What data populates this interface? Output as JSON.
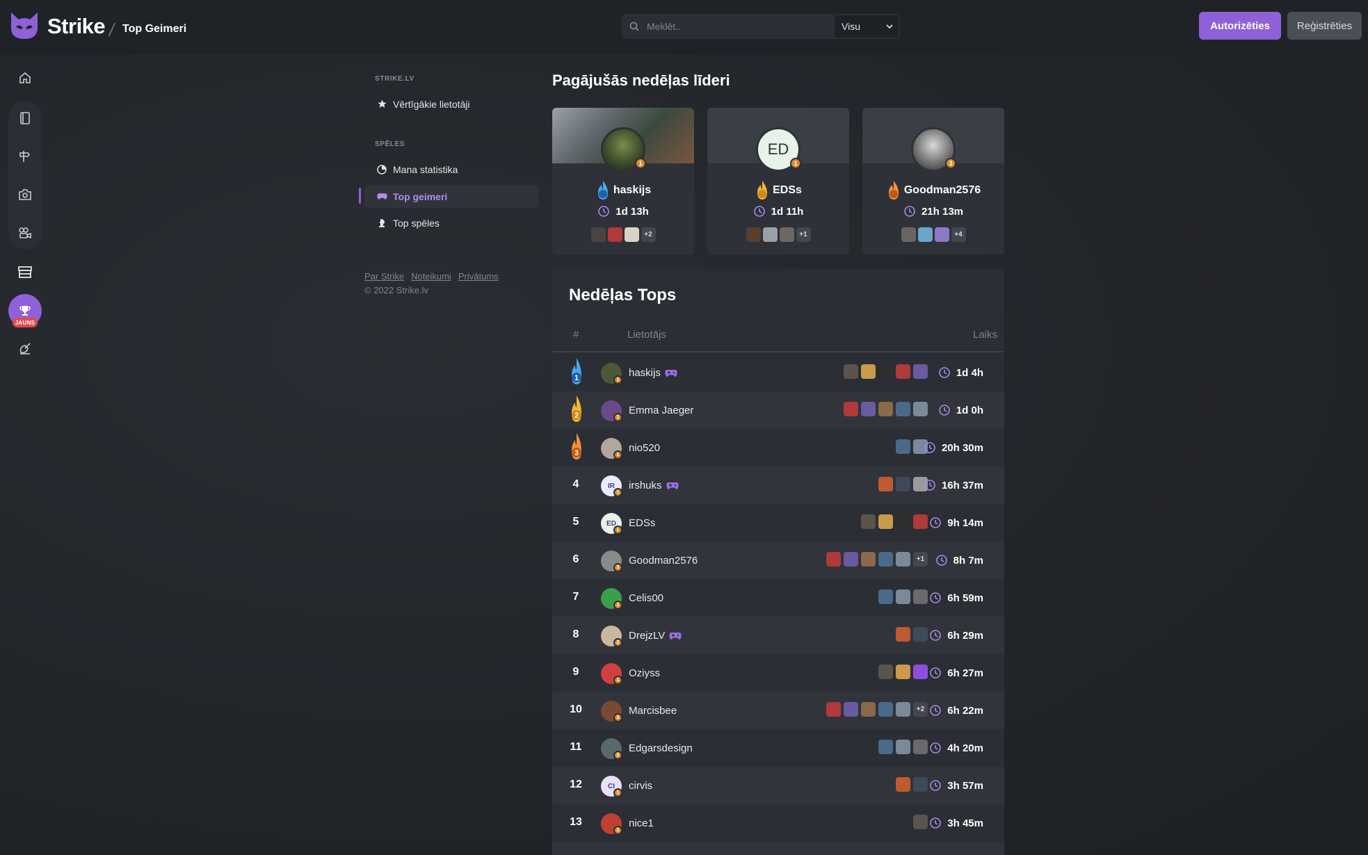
{
  "header": {
    "brand": "Strike",
    "page_title": "Top Geimeri",
    "search_placeholder": "Meklēt..",
    "search_scope": "Visu",
    "login_label": "Autorizēties",
    "register_label": "Reģistrēties",
    "accent": "#8e61d8"
  },
  "rail": {
    "new_badge": "JAUNS",
    "icons": [
      "home-icon",
      "book-icon",
      "signpost-icon",
      "camera-icon",
      "stream-icon",
      "store-icon",
      "trophy-icon",
      "satellite-icon"
    ]
  },
  "sidebar": {
    "section1": "STRIKE.LV",
    "section2": "SPĒLES",
    "items": [
      {
        "label": "Vērtīgākie lietotāji",
        "icon": "star-icon"
      },
      {
        "label": "Mana statistika",
        "icon": "pie-chart-icon"
      },
      {
        "label": "Top geimeri",
        "icon": "gamepad-icon",
        "active": true
      },
      {
        "label": "Top spēles",
        "icon": "chess-icon"
      }
    ],
    "footer_links": [
      "Par Strike",
      "Noteikumi",
      "Privātums"
    ],
    "copyright": "© 2022 Strike.lv"
  },
  "leaders": {
    "title": "Pagājušās nedēļas līderi",
    "cards": [
      {
        "rank": "1",
        "name": "haskijs",
        "time": "1d 13h",
        "level": "1",
        "more": "+2",
        "initials": ""
      },
      {
        "rank": "2",
        "name": "EDSs",
        "time": "1d 11h",
        "level": "1",
        "more": "+1",
        "initials": "ED"
      },
      {
        "rank": "3",
        "name": "Goodman2576",
        "time": "21h 13m",
        "level": "3",
        "more": "+4",
        "initials": ""
      }
    ]
  },
  "weekly": {
    "title": "Nedēļas Tops",
    "col_rank": "#",
    "col_user": "Lietotājs",
    "col_time": "Laiks",
    "rows": [
      {
        "rank": "1",
        "name": "haskijs",
        "time": "1d 4h",
        "level": "1",
        "initials": "",
        "more": "",
        "controller": true
      },
      {
        "rank": "2",
        "name": "Emma Jaeger",
        "time": "1d 0h",
        "level": "1",
        "initials": "",
        "more": "",
        "controller": false
      },
      {
        "rank": "3",
        "name": "nio520",
        "time": "20h 30m",
        "level": "1",
        "initials": "",
        "more": "",
        "controller": false
      },
      {
        "rank": "4",
        "name": "irshuks",
        "time": "16h 37m",
        "level": "1",
        "initials": "IR",
        "more": "",
        "controller": true
      },
      {
        "rank": "5",
        "name": "EDSs",
        "time": "9h 14m",
        "level": "1",
        "initials": "ED",
        "more": "",
        "controller": false
      },
      {
        "rank": "6",
        "name": "Goodman2576",
        "time": "8h 7m",
        "level": "3",
        "initials": "",
        "more": "+1",
        "controller": false
      },
      {
        "rank": "7",
        "name": "Celis00",
        "time": "6h 59m",
        "level": "1",
        "initials": "",
        "more": "",
        "controller": false
      },
      {
        "rank": "8",
        "name": "DrejzLV",
        "time": "6h 29m",
        "level": "2",
        "initials": "",
        "more": "",
        "controller": true
      },
      {
        "rank": "9",
        "name": "Oziyss",
        "time": "6h 27m",
        "level": "1",
        "initials": "",
        "more": "",
        "controller": false
      },
      {
        "rank": "10",
        "name": "Marcisbee",
        "time": "6h 22m",
        "level": "3",
        "initials": "",
        "more": "+2",
        "controller": false
      },
      {
        "rank": "11",
        "name": "Edgarsdesign",
        "time": "4h 20m",
        "level": "2",
        "initials": "",
        "more": "",
        "controller": false
      },
      {
        "rank": "12",
        "name": "cirvis",
        "time": "3h 57m",
        "level": "1",
        "initials": "CI",
        "more": "",
        "controller": false
      },
      {
        "rank": "13",
        "name": "nice1",
        "time": "3h 45m",
        "level": "1",
        "initials": "",
        "more": "",
        "controller": false
      }
    ]
  }
}
